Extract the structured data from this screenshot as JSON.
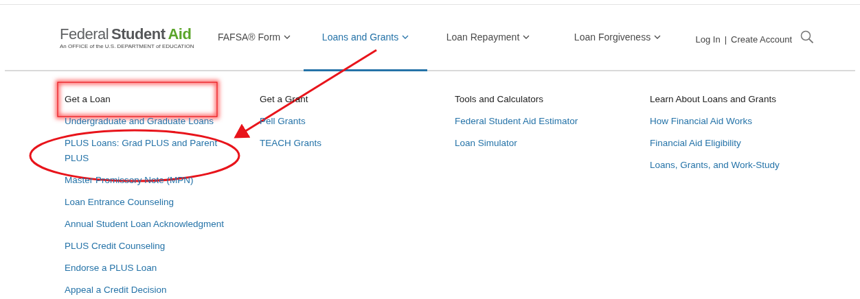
{
  "logo": {
    "name_parts": [
      "Federal",
      "Student",
      "Aid"
    ],
    "tagline": "An OFFICE of the U.S. DEPARTMENT of EDUCATION"
  },
  "nav": [
    {
      "label": "FAFSA® Form",
      "selected": false
    },
    {
      "label": "Loans and Grants",
      "selected": true
    },
    {
      "label": "Loan Repayment",
      "selected": false
    },
    {
      "label": "Loan Forgiveness",
      "selected": false
    }
  ],
  "account_links": [
    "Log In",
    "|",
    "Create Account"
  ],
  "menu_columns": [
    {
      "heading": "Get a Loan",
      "links": [
        "Undergraduate and Graduate Loans",
        "PLUS Loans: Grad PLUS and Parent PLUS",
        "Master Promissory Note (MPN)",
        "Loan Entrance Counseling",
        "Annual Student Loan Acknowledgment",
        "PLUS Credit Counseling",
        "Endorse a PLUS Loan",
        "Appeal a Credit Decision"
      ]
    },
    {
      "heading": "Get a Grant",
      "links": [
        "Pell Grants",
        "TEACH Grants"
      ]
    },
    {
      "heading": "Tools and Calculators",
      "links": [
        "Federal Student Aid Estimator",
        "Loan Simulator"
      ]
    },
    {
      "heading": "Learn About Loans and Grants",
      "links": [
        "How Financial Aid Works",
        "Financial Aid Eligibility",
        "Loans, Grants, and Work-Study"
      ]
    }
  ],
  "annotations": [
    {
      "kind": "box"
    },
    {
      "kind": "ellipse"
    },
    {
      "kind": "arrow"
    }
  ]
}
